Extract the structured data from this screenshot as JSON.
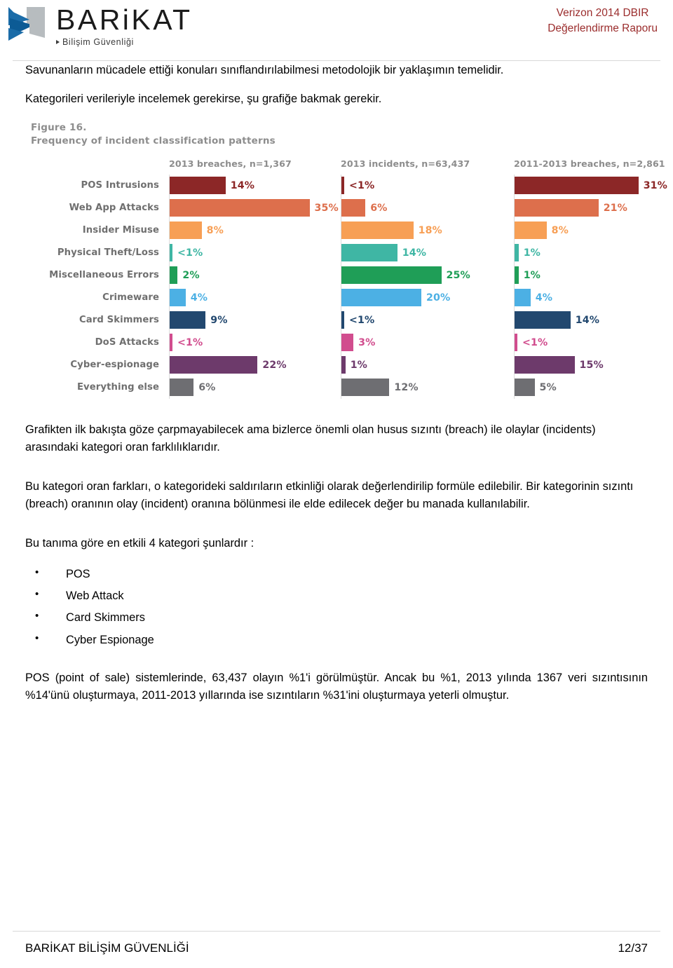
{
  "header": {
    "logo_word": "BARiKAT",
    "logo_sub": "Bilişim Güvenliği",
    "report_line1": "Verizon 2014 DBIR",
    "report_line2": "Değerlendirme Raporu",
    "accent_color": "#9b2d2d"
  },
  "intro": {
    "p1": "Savunanların mücadele ettiği konuları sınıflandırılabilmesi metodolojik bir yaklaşımın temelidir.",
    "p2": "Kategorileri verileriyle incelemek gerekirse, şu grafiğe bakmak gerekir."
  },
  "body": {
    "p1": "Grafikten ilk bakışta göze çarpmayabilecek ama bizlerce önemli olan husus sızıntı (breach) ile olaylar (incidents) arasındaki kategori oran farklılıklarıdır.",
    "p2": "Bu kategori oran farkları, o kategorideki saldırıların etkinliği olarak değerlendirilip formüle edilebilir. Bir kategorinin sızıntı (breach) oranının olay (incident) oranına bölünmesi ile elde edilecek değer bu manada kullanılabilir.",
    "list_intro": "Bu tanıma göre en etkili 4 kategori şunlardır :",
    "bullets": [
      "POS",
      "Web Attack",
      "Card Skimmers",
      "Cyber Espionage"
    ],
    "p3": "POS (point of sale) sistemlerinde, 63,437 olayın %1'i görülmüştür. Ancak bu %1, 2013 yılında 1367 veri sızıntısının %14'ünü oluşturmaya, 2011-2013 yıllarında ise sızıntıların %31'ini oluşturmaya yeterli olmuştur."
  },
  "footer": {
    "left": "BARİKAT BİLİŞİM GÜVENLİĞİ",
    "right": "12/37"
  },
  "chart_data": {
    "type": "bar",
    "title": "Figure 16.",
    "subtitle": "Frequency of incident classification patterns",
    "orientation": "horizontal",
    "grid": false,
    "legend_position": "none",
    "xlabel": "",
    "ylabel": "",
    "xlim": [
      0,
      40
    ],
    "categories": [
      "POS Intrusions",
      "Web App Attacks",
      "Insider Misuse",
      "Physical Theft/Loss",
      "Miscellaneous Errors",
      "Crimeware",
      "Card Skimmers",
      "DoS Attacks",
      "Cyber-espionage",
      "Everything else"
    ],
    "category_colors": [
      "#8c2727",
      "#dd6f4c",
      "#f79f55",
      "#3fb6a4",
      "#1f9e57",
      "#4cb0e4",
      "#22486f",
      "#d14d8e",
      "#6d3a6b",
      "#6e6e72"
    ],
    "series": [
      {
        "name": "2013 breaches, n=1,367",
        "labels": [
          "14%",
          "35%",
          "8%",
          "<1%",
          "2%",
          "4%",
          "9%",
          "<1%",
          "22%",
          "6%"
        ],
        "values": [
          14,
          35,
          8,
          0.5,
          2,
          4,
          9,
          0.5,
          22,
          6
        ]
      },
      {
        "name": "2013 incidents, n=63,437",
        "labels": [
          "<1%",
          "6%",
          "18%",
          "14%",
          "25%",
          "20%",
          "<1%",
          "3%",
          "1%",
          "12%"
        ],
        "values": [
          0.5,
          6,
          18,
          14,
          25,
          20,
          0.5,
          3,
          1,
          12
        ]
      },
      {
        "name": "2011-2013 breaches, n=2,861",
        "labels": [
          "31%",
          "21%",
          "8%",
          "1%",
          "1%",
          "4%",
          "14%",
          "<1%",
          "15%",
          "5%"
        ],
        "values": [
          31,
          21,
          8,
          1,
          1,
          4,
          14,
          0.5,
          15,
          5
        ]
      }
    ]
  }
}
